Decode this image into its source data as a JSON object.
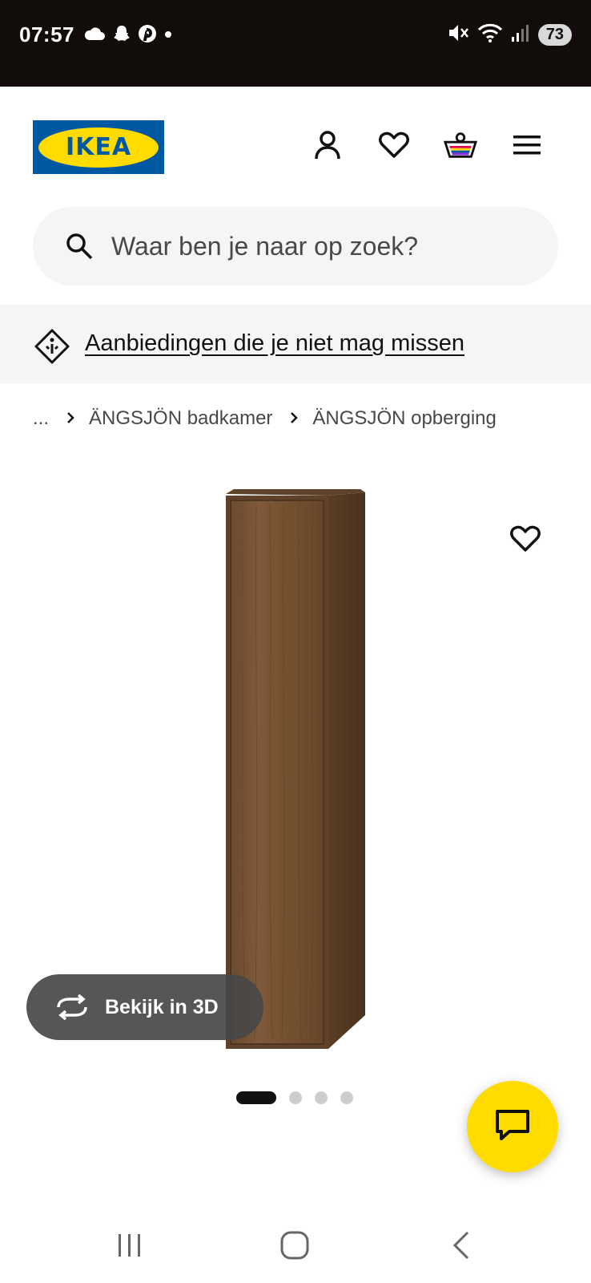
{
  "status_bar": {
    "time": "07:57",
    "battery": "73",
    "left_icons": [
      "cloud-icon",
      "snapchat-icon",
      "pinterest-icon",
      "dot-icon"
    ],
    "right_icons": [
      "mute-icon",
      "wifi-icon",
      "signal-icon"
    ]
  },
  "header": {
    "logo_text": "IKEA",
    "icons": [
      "account-icon",
      "heart-icon",
      "cart-icon",
      "menu-icon"
    ]
  },
  "search": {
    "placeholder": "Waar ben je naar op zoek?"
  },
  "promo": {
    "label": "Aanbiedingen die je niet mag missen"
  },
  "breadcrumb": {
    "items": [
      "...",
      "ÄNGSJÖN badkamer",
      "ÄNGSJÖN opberging"
    ]
  },
  "product": {
    "view_3d_label": "Bekijk in 3D",
    "image_count": 4,
    "active_image": 1
  },
  "colors": {
    "ikea_blue": "#0058a3",
    "ikea_yellow": "#ffdb00",
    "text_primary": "#111111",
    "text_secondary": "#484848"
  }
}
